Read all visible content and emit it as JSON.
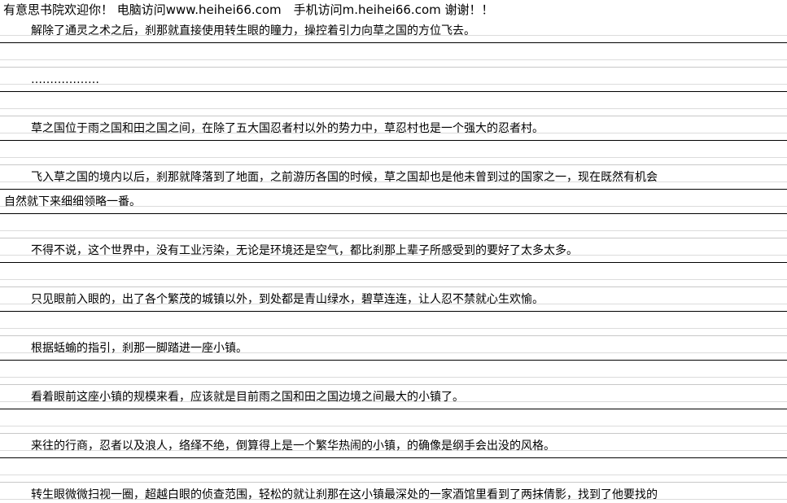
{
  "header": {
    "text": "有意思书院欢迎你！ 电脑访问www.heihei66.com　手机访问m.heihei66.com 谢谢！！"
  },
  "lines": [
    {
      "text": "解除了通灵之术之后，刹那就直接使用转生眼的瞳力，操控着引力向草之国的方位飞去。",
      "indent": true
    },
    {
      "text": "………………",
      "indent": true
    },
    {
      "text": "草之国位于雨之国和田之国之间，在除了五大国忍者村以外的势力中，草忍村也是一个强大的忍者村。",
      "indent": true
    },
    {
      "text": "飞入草之国的境内以后，刹那就降落到了地面，之前游历各国的时候，草之国却也是他未曾到过的国家之一，现在既然有机会",
      "indent": true
    },
    {
      "text": "自然就下来细细领略一番。",
      "indent": false
    },
    {
      "text": "不得不说，这个世界中，没有工业污染，无论是环境还是空气，都比刹那上辈子所感受到的要好了太多太多。",
      "indent": true
    },
    {
      "text": "只见眼前入眼的，出了各个繁茂的城镇以外，到处都是青山绿水，碧草连连，让人忍不禁就心生欢愉。",
      "indent": true
    },
    {
      "text": "根据蛞蝓的指引，刹那一脚踏进一座小镇。",
      "indent": true
    },
    {
      "text": "看着眼前这座小镇的规模来看，应该就是目前雨之国和田之国边境之间最大的小镇了。",
      "indent": true
    },
    {
      "text": "来往的行商，忍者以及浪人，络绎不绝，倒算得上是一个繁华热闹的小镇，的确像是纲手会出没的风格。",
      "indent": true
    },
    {
      "text": "转生眼微微扫视一圈，超越白眼的侦查范围，轻松的就让刹那在这小镇最深处的一家酒馆里看到了两抹倩影，找到了他要找的",
      "indent": true
    }
  ]
}
